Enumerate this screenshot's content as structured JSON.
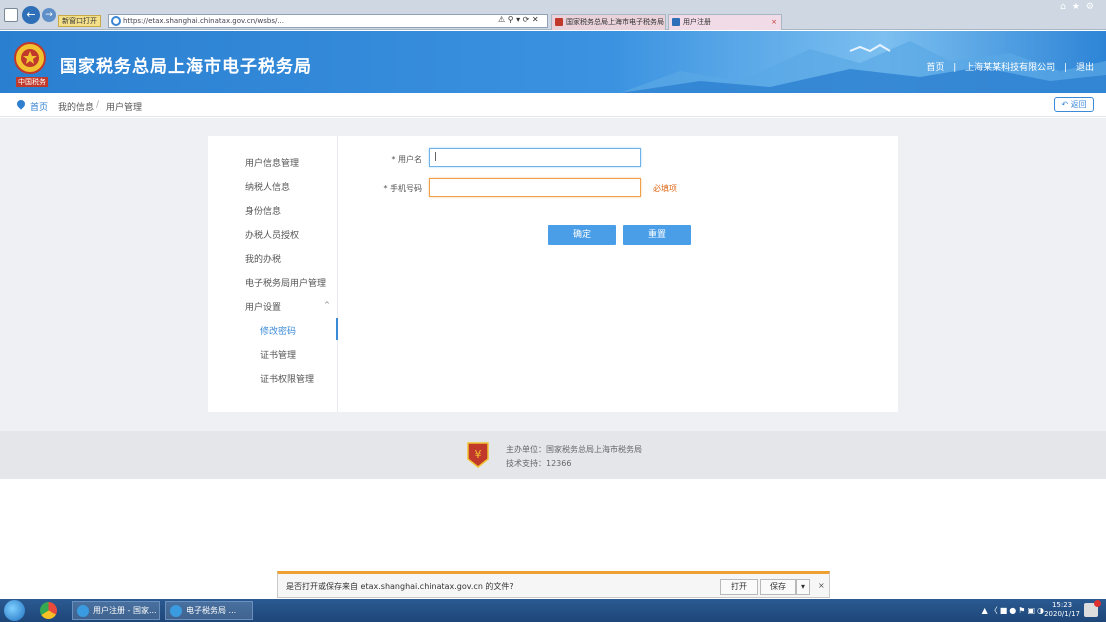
{
  "browser": {
    "fav_chip": "新窗口打开",
    "address": "https://etax.shanghai.chinatax.gov.cn/wsbs/...",
    "tabs": [
      {
        "label": "国家税务总局上海市电子税务局"
      },
      {
        "label": "用户注册"
      }
    ],
    "tab_close": "×"
  },
  "header": {
    "title": "国家税务总局上海市电子税务局",
    "logo_sub": "中国税务",
    "links": [
      "首页",
      "|",
      "上海某某科技有限公司",
      "|",
      "退出"
    ]
  },
  "breadcrumb": {
    "home": "首页",
    "level2": "我的信息",
    "level3": "用户管理",
    "separator": "/",
    "back_label": "返回"
  },
  "side_menu": {
    "items": [
      "用户信息管理",
      "纳税人信息",
      "身份信息",
      "办税人员授权",
      "我的办税",
      "电子税务局用户管理",
      "用户设置"
    ],
    "expand_arrow": "^",
    "sub_items": [
      "修改密码",
      "证书管理",
      "证书权限管理"
    ]
  },
  "form": {
    "label_1": "* 用户名",
    "input_1_value": "|",
    "label_2": "* 手机号码",
    "input_2_value": "",
    "hint": "必填项",
    "submit_label": "确定",
    "reset_label": "重置"
  },
  "footer": {
    "line1": "主办单位：国家税务总局上海市税务局",
    "line2": "技术支持：12366"
  },
  "download_bar": {
    "text": "是否打开或保存来自 etax.shanghai.chinatax.gov.cn 的文件?",
    "open_label": "打开",
    "save_label": "保存",
    "drop_label": "▾",
    "close_label": "×"
  },
  "taskbar": {
    "task_1": "用户注册 - 国家...",
    "task_2": "电子税务局 ...",
    "clock_time": "15:23",
    "clock_date": "2020/1/17"
  },
  "colors": {
    "header_blue": "#2b7fd0",
    "accent_blue": "#4a9ee8",
    "warning_orange": "#e06a1a"
  }
}
